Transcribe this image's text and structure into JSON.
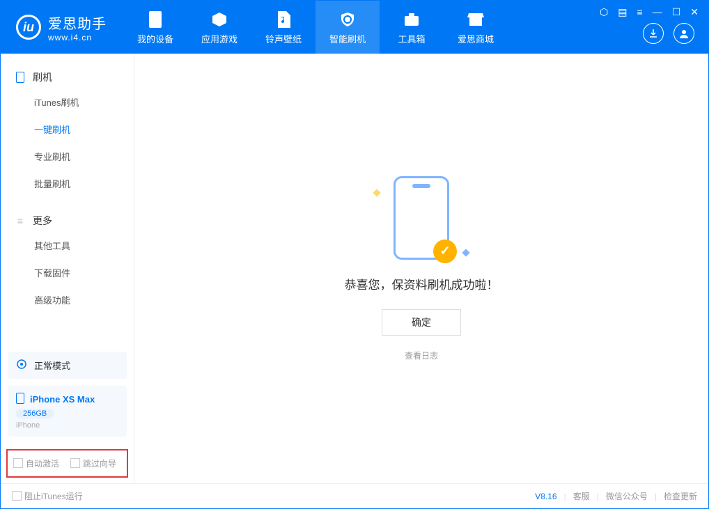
{
  "app": {
    "name": "爱思助手",
    "url": "www.i4.cn",
    "logo_letter": "iu"
  },
  "nav": {
    "items": [
      {
        "label": "我的设备"
      },
      {
        "label": "应用游戏"
      },
      {
        "label": "铃声壁纸"
      },
      {
        "label": "智能刷机"
      },
      {
        "label": "工具箱"
      },
      {
        "label": "爱思商城"
      }
    ]
  },
  "sidebar": {
    "group1": {
      "title": "刷机",
      "items": [
        "iTunes刷机",
        "一键刷机",
        "专业刷机",
        "批量刷机"
      ]
    },
    "group2": {
      "title": "更多",
      "items": [
        "其他工具",
        "下载固件",
        "高级功能"
      ]
    },
    "mode": "正常模式",
    "device": {
      "name": "iPhone XS Max",
      "storage": "256GB",
      "type": "iPhone"
    },
    "checks": {
      "auto_activate": "自动激活",
      "skip_guide": "跳过向导"
    }
  },
  "main": {
    "success_text": "恭喜您，保资料刷机成功啦！",
    "ok_button": "确定",
    "log_link": "查看日志"
  },
  "footer": {
    "block_itunes": "阻止iTunes运行",
    "version": "V8.16",
    "links": [
      "客服",
      "微信公众号",
      "检查更新"
    ]
  }
}
